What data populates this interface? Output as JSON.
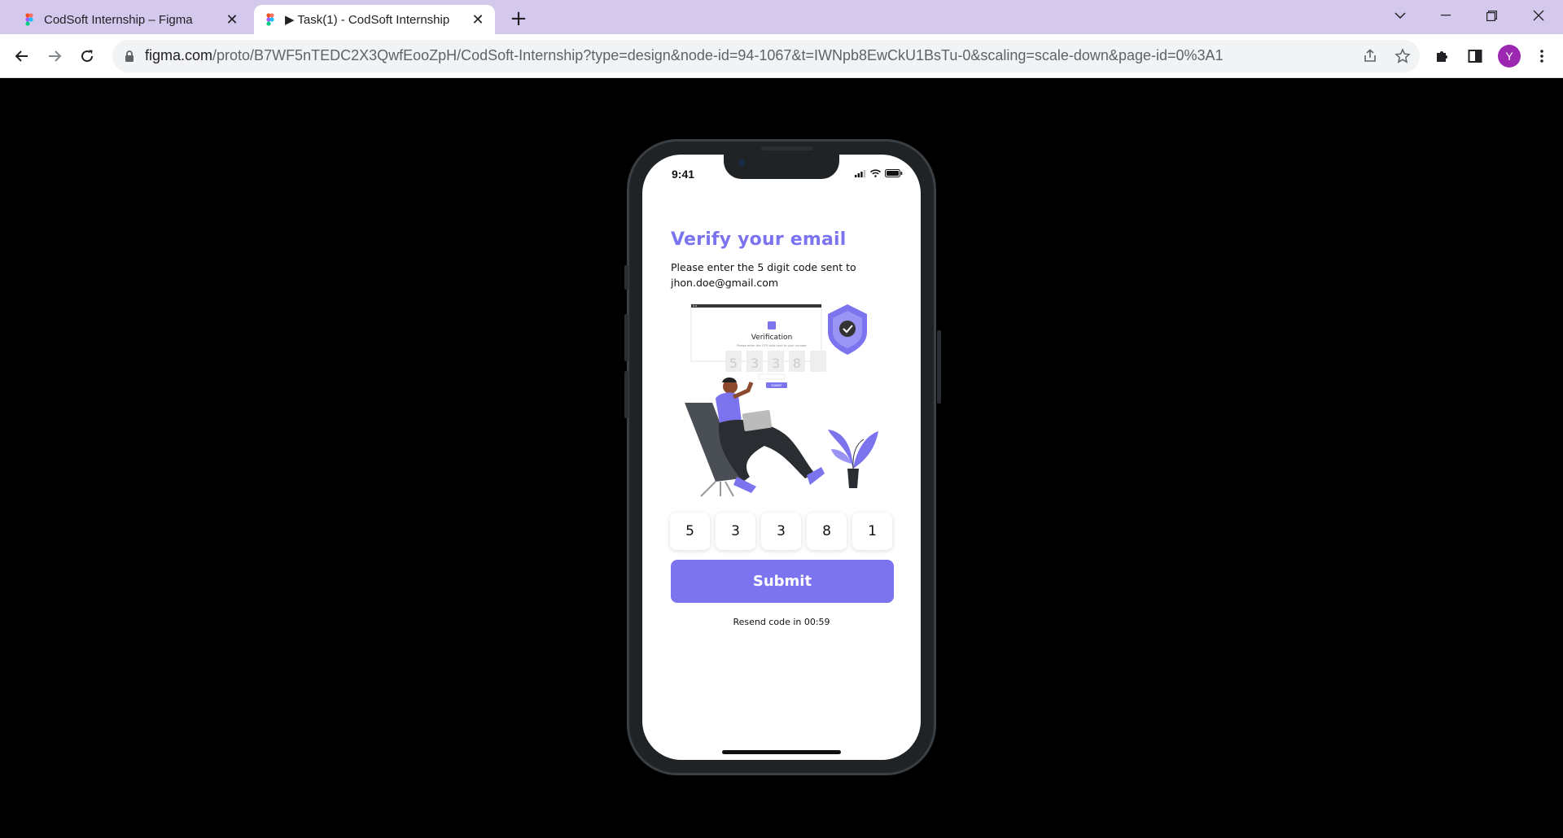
{
  "browser": {
    "tabs": [
      {
        "title": "CodSoft Internship – Figma",
        "active": false
      },
      {
        "title": "▶ Task(1) - CodSoft Internship",
        "active": true
      }
    ],
    "url_host": "figma.com",
    "url_path": "/proto/B7WF5nTEDC2X3QwfEooZpH/CodSoft-Internship?type=design&node-id=94-1067&t=IWNpb8EwCkU1BsTu-0&scaling=scale-down&page-id=0%3A1",
    "avatar_letter": "Y",
    "colors": {
      "tabbar": "#d4c9ec",
      "avatar": "#9c27b0"
    }
  },
  "phone": {
    "status_time": "9:41",
    "title": "Verify your email",
    "subtitle_line1": "Please enter the 5 digit code sent to",
    "subtitle_line2": "jhon.doe@gmail.com",
    "illustration": {
      "card_title": "Verification",
      "card_subtitle": "Please enter the OTP code sent to your number",
      "card_digits": [
        "5",
        "3",
        "3",
        "8",
        ""
      ],
      "card_button": "SUBMIT"
    },
    "otp_digits": [
      "5",
      "3",
      "3",
      "8",
      "1"
    ],
    "submit_label": "Submit",
    "resend_text": "Resend code in 00:59",
    "colors": {
      "accent": "#7b74ee"
    }
  }
}
